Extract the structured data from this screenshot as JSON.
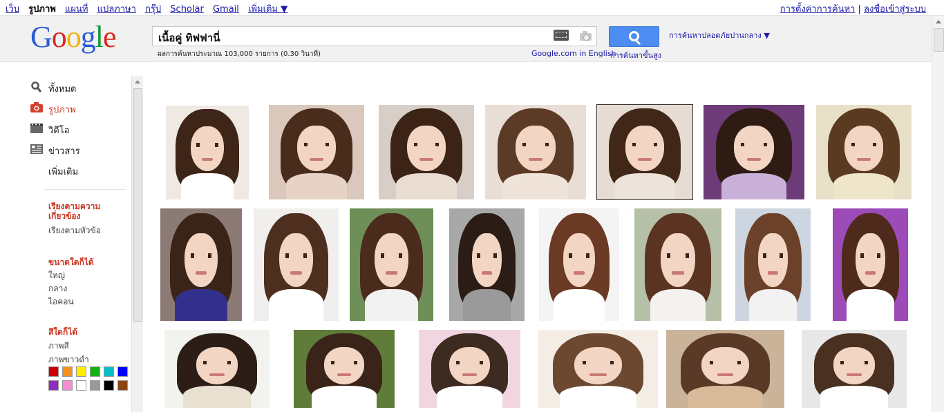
{
  "top_nav": {
    "items": [
      "เว็บ",
      "รูปภาพ",
      "แผนที่",
      "แปลภาษา",
      "กรุ๊ป",
      "Scholar",
      "Gmail",
      "เพิ่มเติม ▼"
    ],
    "selected": "รูปภาพ",
    "settings_link": "การตั้งค่าการค้นหา",
    "divider": "|",
    "signin_link": "ลงชื่อเข้าสู่ระบบ"
  },
  "header": {
    "logo_letters": [
      "G",
      "o",
      "o",
      "g",
      "l",
      "e"
    ],
    "query": "เนื้อคู่ ทิฟฟานี่",
    "search_button_icon": "search-icon",
    "safe_search": "การค้นหาปลอดภัยปานกลาง ▼",
    "stats": "ผลการค้นหาประมาณ 103,000 รายการ (0.30 วินาที)",
    "english_link": "Google.com in English",
    "advanced_link": "การค้นหาขั้นสูง"
  },
  "sidebar": {
    "modes": [
      {
        "label": "ทั้งหมด",
        "icon": "search-icon"
      },
      {
        "label": "รูปภาพ",
        "icon": "camera-icon"
      },
      {
        "label": "วิดีโอ",
        "icon": "film-icon"
      },
      {
        "label": "ข่าวสาร",
        "icon": "news-icon"
      },
      {
        "label": "เพิ่มเติม",
        "icon": ""
      }
    ],
    "sort_heading": "เรียงตามความ เกี่ยวข้อง",
    "sort_option": "เรียงตามหัวข้อ",
    "size_heading": "ขนาดใดก็ได้",
    "size_options": [
      "ใหญ่",
      "กลาง",
      "ไอคอน"
    ],
    "color_heading": "สีใดก็ได้",
    "color_options": [
      "ภาพสี",
      "ภาพขาวดำ"
    ],
    "swatches": [
      "#cc0000",
      "#f6901e",
      "#ffee00",
      "#13b213",
      "#0dbec8",
      "#0000ff",
      "#8f2dbf",
      "#f58ed1",
      "#ffffff",
      "#999999",
      "#000000",
      "#8b4513"
    ]
  },
  "accent": {
    "brand_blue": "#2a5cd6",
    "link": "#1a1aa6",
    "heading_red": "#c9341f",
    "button_blue": "#4d8cf0"
  }
}
